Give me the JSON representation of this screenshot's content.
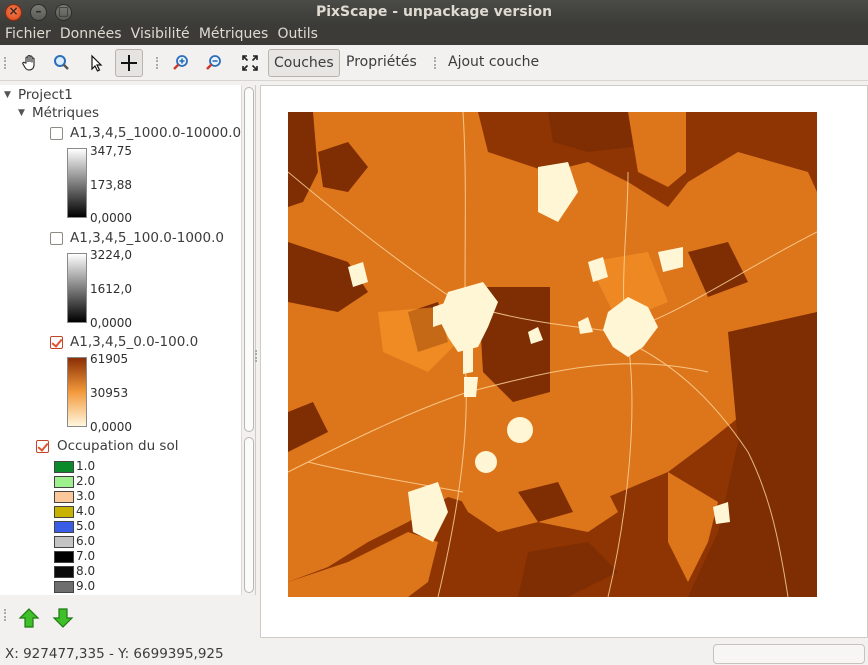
{
  "window": {
    "title": "PixScape - unpackage version"
  },
  "menu": [
    "Fichier",
    "Données",
    "Visibilité",
    "Métriques",
    "Outils"
  ],
  "toolbar": {
    "tools": [
      "pan-hand-icon",
      "zoom-icon",
      "select-arrow-icon",
      "crosshair-icon",
      "zoom-in-icon",
      "zoom-out-icon",
      "fit-extent-icon"
    ],
    "tabs": [
      "Couches",
      "Propriétés",
      "Ajout couche"
    ],
    "active_tab": "Couches"
  },
  "tree": {
    "root": "Project1",
    "group": "Métriques",
    "layers": [
      {
        "name": "A1,3,4,5_1000.0-10000.0",
        "checked": false,
        "max": "347,75",
        "mid": "173,88",
        "min": "0,0000",
        "gradient": [
          "#ffffff",
          "#000000"
        ]
      },
      {
        "name": "A1,3,4,5_100.0-1000.0",
        "checked": false,
        "max": "3224,0",
        "mid": "1612,0",
        "min": "0,0000",
        "gradient": [
          "#ffffff",
          "#000000"
        ]
      },
      {
        "name": "A1,3,4,5_0.0-100.0",
        "checked": true,
        "max": "61905",
        "mid": "30953",
        "min": "0,0000",
        "gradient": [
          "#fff7de",
          "#f39a3c",
          "#8a2f05"
        ]
      }
    ],
    "landuse": {
      "name": "Occupation du sol",
      "checked": true,
      "classes": [
        {
          "label": "1.0",
          "color": "#0a8a2a"
        },
        {
          "label": "2.0",
          "color": "#9ef08f"
        },
        {
          "label": "3.0",
          "color": "#fcc89a"
        },
        {
          "label": "4.0",
          "color": "#c8b400"
        },
        {
          "label": "5.0",
          "color": "#3a5de8"
        },
        {
          "label": "6.0",
          "color": "#c4c4c4"
        },
        {
          "label": "7.0",
          "color": "#000000"
        },
        {
          "label": "8.0",
          "color": "#0a0a0a"
        },
        {
          "label": "9.0",
          "color": "#6e6e6e"
        }
      ]
    }
  },
  "status": {
    "coords": "X: 927477,335 - Y: 6699395,925"
  },
  "map": {
    "background": "#8f3503",
    "fill": "#e07a1c",
    "urban": "#fff6d6"
  }
}
